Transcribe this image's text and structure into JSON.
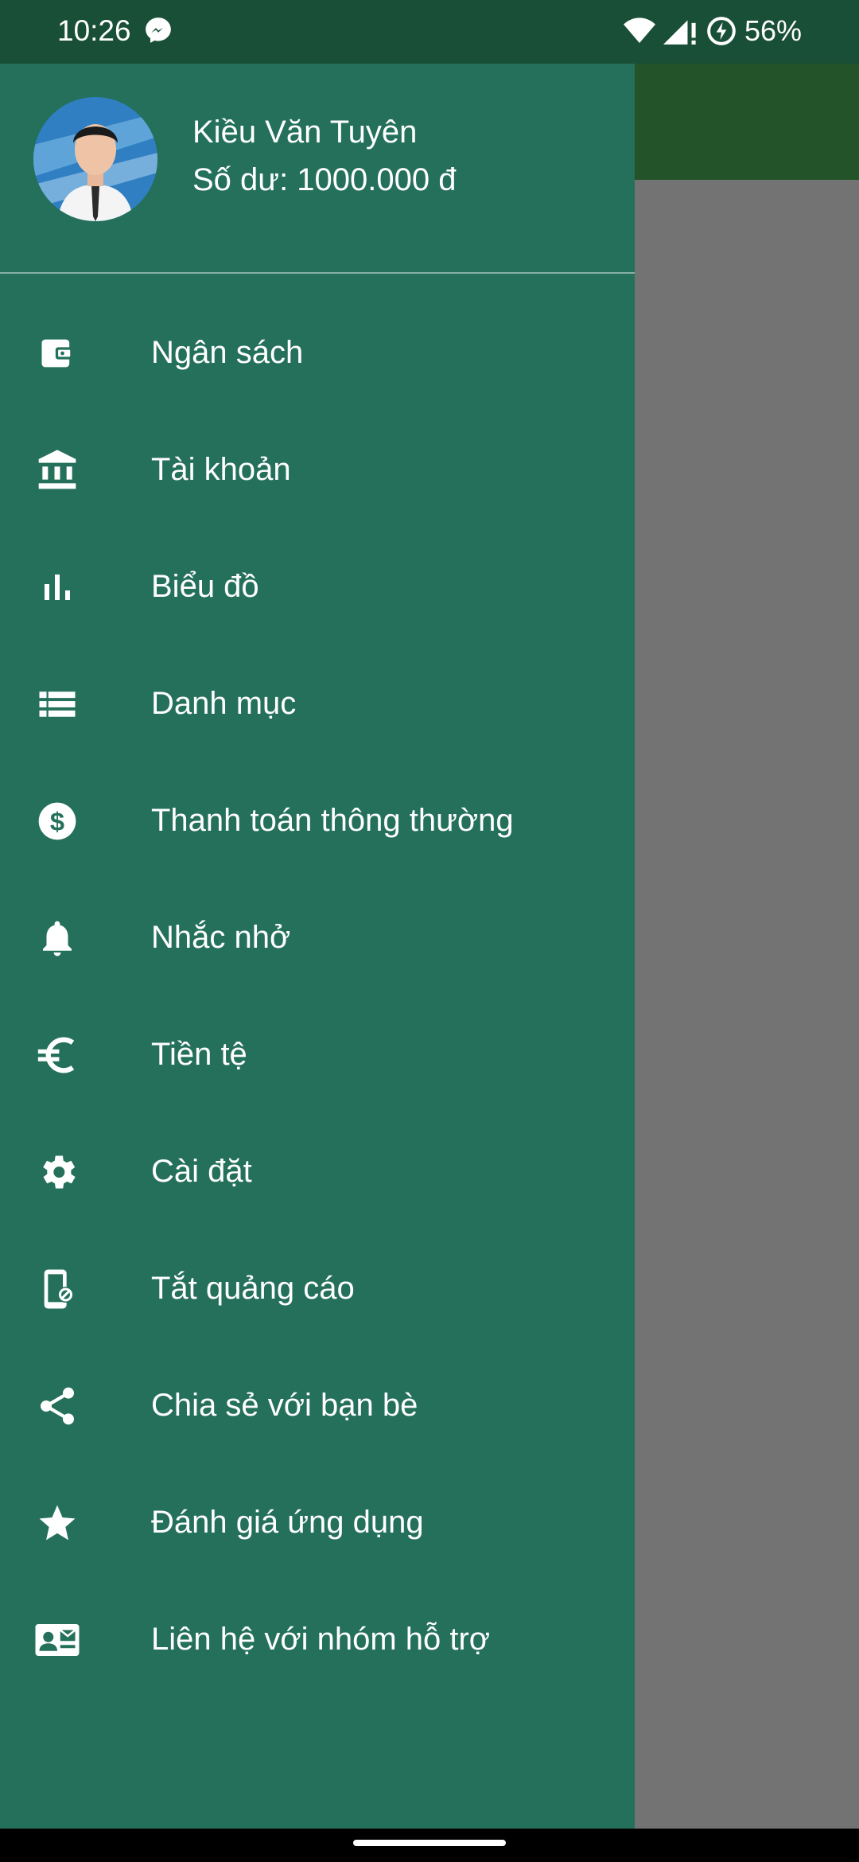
{
  "status_bar": {
    "time": "10:26",
    "battery": "56%",
    "icons": [
      "messenger-icon",
      "wifi-icon",
      "signal-icon",
      "battery-saver-icon"
    ]
  },
  "profile": {
    "name": "Kiều Văn Tuyên",
    "balance": "Số dư: 1000.000 đ"
  },
  "menu": [
    {
      "label": "Ngân sách",
      "icon": "wallet-icon"
    },
    {
      "label": "Tài khoản",
      "icon": "bank-icon"
    },
    {
      "label": "Biểu đồ",
      "icon": "bar-chart-icon"
    },
    {
      "label": "Danh mục",
      "icon": "list-icon"
    },
    {
      "label": "Thanh toán thông thường",
      "icon": "dollar-circle-icon"
    },
    {
      "label": "Nhắc nhở",
      "icon": "bell-icon"
    },
    {
      "label": "Tiền tệ",
      "icon": "euro-icon"
    },
    {
      "label": "Cài đặt",
      "icon": "gear-icon"
    },
    {
      "label": "Tắt quảng cáo",
      "icon": "phone-block-icon"
    },
    {
      "label": "Chia sẻ với bạn bè",
      "icon": "share-icon"
    },
    {
      "label": "Đánh giá ứng dụng",
      "icon": "star-icon"
    },
    {
      "label": "Liên hệ với nhóm hỗ trợ",
      "icon": "contact-card-icon"
    }
  ],
  "colors": {
    "drawer": "#24705a",
    "status_bar": "#1a4f37",
    "app_bar": "#235329",
    "scrim": "#737373"
  }
}
